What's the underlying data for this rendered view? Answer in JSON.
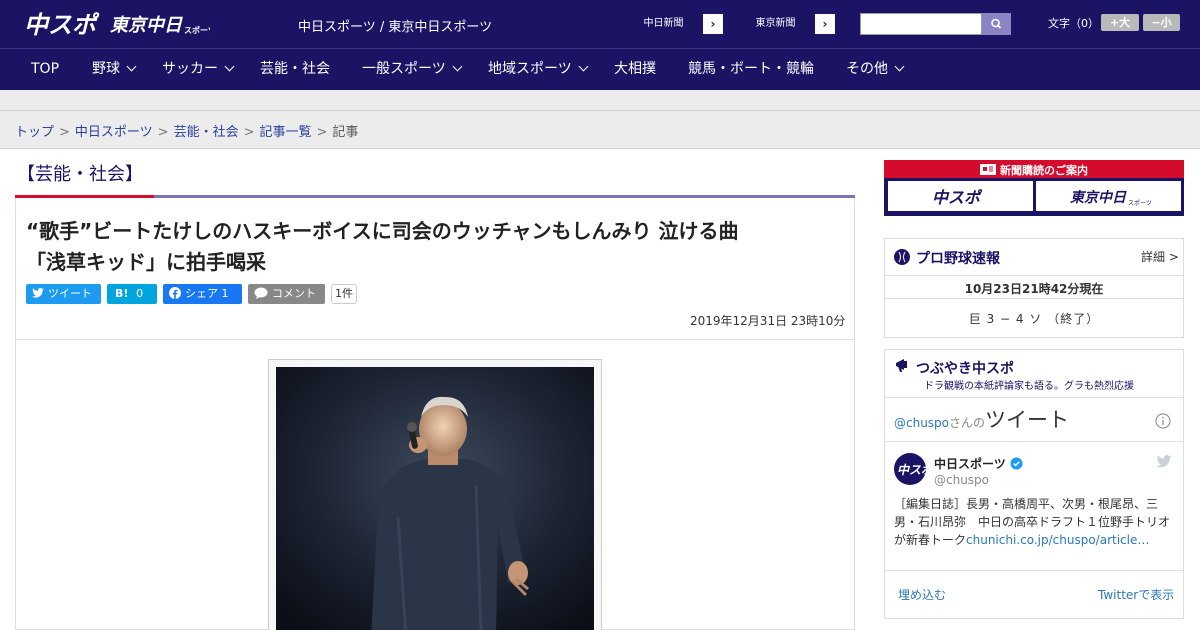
{
  "header": {
    "logo_chuspo": "中スポ",
    "logo_tokyo": "東京中日",
    "logo_tokyo_sub": "スポーツ",
    "site_names": "中日スポーツ / 東京中日スポーツ",
    "paper_buttons": [
      {
        "label": "中日新聞",
        "arrow": "›"
      },
      {
        "label": "東京新聞",
        "arrow": "›"
      }
    ],
    "font_label": "文字（0）",
    "font_bigger": "+大",
    "font_smaller": "−小",
    "brand_color": "#1b1464",
    "accent_color": "#d50b2d"
  },
  "nav": {
    "items": [
      {
        "label": "TOP",
        "dropdown": false
      },
      {
        "label": "野球",
        "dropdown": true
      },
      {
        "label": "サッカー",
        "dropdown": true
      },
      {
        "label": "芸能・社会",
        "dropdown": false
      },
      {
        "label": "一般スポーツ",
        "dropdown": true
      },
      {
        "label": "地域スポーツ",
        "dropdown": true
      },
      {
        "label": "大相撲",
        "dropdown": false
      },
      {
        "label": "競馬・ボート・競輪",
        "dropdown": false
      },
      {
        "label": "その他",
        "dropdown": true
      }
    ]
  },
  "breadcrumb": {
    "items": [
      "トップ",
      "中日スポーツ",
      "芸能・社会",
      "記事一覧"
    ],
    "current": "記事",
    "separator": ">"
  },
  "article": {
    "category": "【芸能・社会】",
    "headline_line1": "“歌手”ビートたけしのハスキーボイスに司会のウッチャンもしんみり 泣ける曲",
    "headline_line2": "「浅草キッド」に拍手喝采",
    "share": {
      "tweet": "ツイート",
      "hatena": "B!",
      "hatena_count": "0",
      "facebook": "シェア",
      "facebook_count": "1",
      "comment": "コメント",
      "comment_count": "1件"
    },
    "date": "2019年12月31日 23時10分"
  },
  "sidebar": {
    "ad_title": "新聞購読のご案内",
    "ad_logo_1": "中スポ",
    "ad_logo_2": "東京中日",
    "ad_logo_2_sub": "スポーツ",
    "baseball": {
      "title": "プロ野球速報",
      "detail": "詳細 >",
      "timestamp": "10月23日21時42分現在",
      "score": "巨 3 − 4 ソ （終了）"
    },
    "tsubuyaki": {
      "title": "つぶやき中スポ",
      "subtitle": "ドラ観戦の本紙評論家も語る。グラも熱烈応援"
    },
    "twitter": {
      "handle_prefix": "@chuspo",
      "handle_suffix": "さんの",
      "heading": "ツイート",
      "account_name": "中日スポーツ",
      "account_handle": "@chuspo",
      "tweet_body": "［編集日誌］長男・高橋周平、次男・根尾昂、三男・石川昂弥　中日の高卒ドラフト１位野手トリオが新春トーク",
      "tweet_link": "chunichi.co.jp/chuspo/article…",
      "embed": "埋め込む",
      "view_on_twitter": "Twitterで表示"
    }
  }
}
